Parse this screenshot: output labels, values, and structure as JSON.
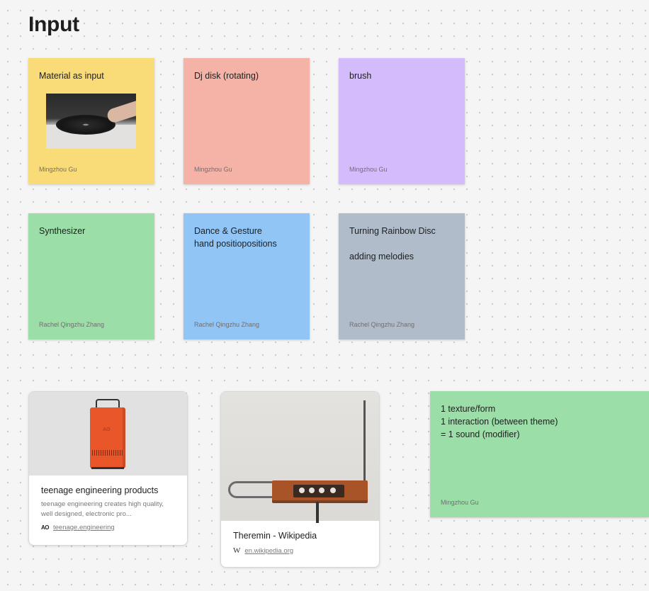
{
  "page": {
    "title": "Input"
  },
  "stickies": [
    {
      "text": "Material as input",
      "author": "Mingzhou Gu",
      "color": "#f9db78"
    },
    {
      "text": "Dj disk (rotating)",
      "author": "Mingzhou Gu",
      "color": "#f5b2a6"
    },
    {
      "text": "brush",
      "author": "Mingzhou Gu",
      "color": "#d4bbfb"
    },
    {
      "text": "Synthesizer",
      "author": "Rachel Qingzhu Zhang",
      "color": "#9cdea8"
    },
    {
      "text": "Dance & Gesture\nhand positiopositions",
      "author": "Rachel Qingzhu Zhang",
      "color": "#90c5f6"
    },
    {
      "text": "Turning Rainbow Disc\n\nadding melodies",
      "author": "Rachel Qingzhu Zhang",
      "color": "#b1bccb"
    },
    {
      "text": "1 texture/form\n1 interaction (between theme)\n= 1 sound (modifier)",
      "author": "Mingzhou Gu",
      "color": "#9cdea8"
    }
  ],
  "link_cards": [
    {
      "title": "teenage engineering products",
      "description": "teenage engineering creates high quality, well designed, electronic pro...",
      "site_logo": "AO",
      "url": "teenage.engineering"
    },
    {
      "title": "Theremin - Wikipedia",
      "site_logo": "W",
      "url": "en.wikipedia.org"
    }
  ]
}
